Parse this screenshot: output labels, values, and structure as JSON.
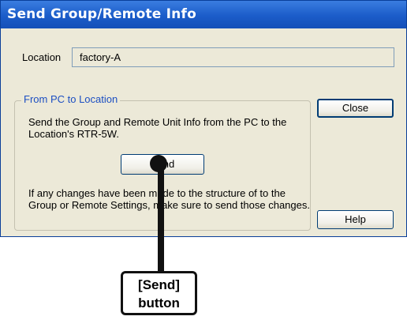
{
  "window": {
    "title": "Send Group/Remote Info",
    "location_label": "Location",
    "location_value": "factory-A"
  },
  "group": {
    "title": "From PC to Location",
    "description": "Send the Group and Remote Unit Info from the PC to the Location's RTR-5W.",
    "send_label": "Send",
    "warning": "If any changes have been made to the structure of to the Group or Remote Settings, make sure to send those changes."
  },
  "buttons": {
    "close_label": "Close",
    "help_label": "Help"
  },
  "callout": {
    "line1": "[Send]",
    "line2": "button"
  },
  "colors": {
    "titlebar": "#1b5cc9",
    "dialog_bg": "#ece9d8",
    "group_title": "#1c4fc2"
  }
}
